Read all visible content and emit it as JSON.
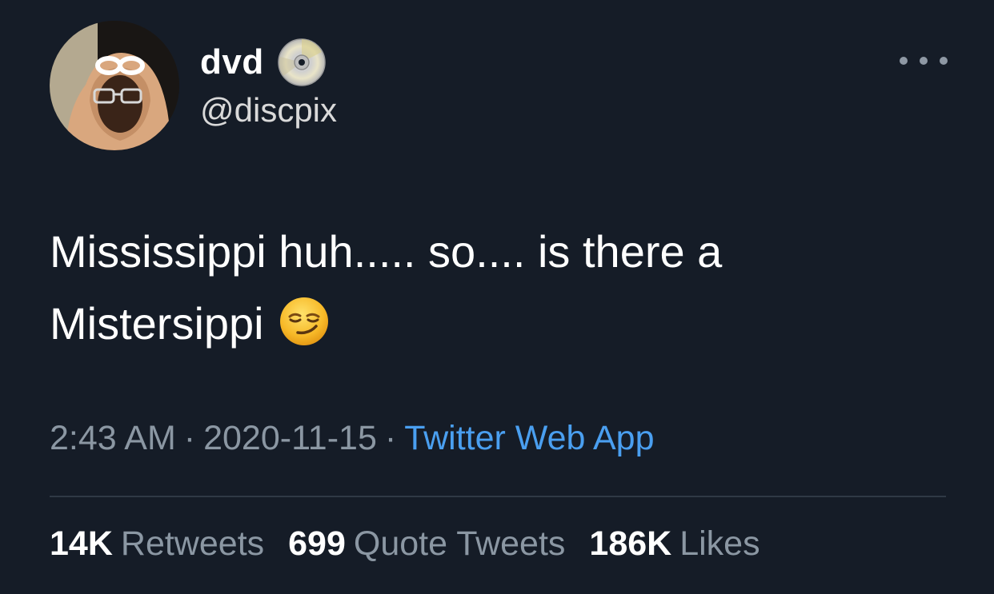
{
  "author": {
    "display_name": "dvd",
    "handle": "@discpix",
    "badge_icon": "dvd-disc-icon",
    "avatar_icon": "profile-avatar"
  },
  "tweet": {
    "text_line_1": "Mississippi huh..... so.... is there a",
    "text_line_2": "Mistersippi",
    "emoji": "smirking-face-emoji"
  },
  "meta": {
    "time": "2:43 AM",
    "separator": "·",
    "date": "2020-11-15",
    "source": "Twitter Web App"
  },
  "stats": {
    "retweets_count": "14K",
    "retweets_label": "Retweets",
    "quotes_count": "699",
    "quotes_label": "Quote Tweets",
    "likes_count": "186K",
    "likes_label": "Likes"
  },
  "menu_icon": "more-options-icon",
  "colors": {
    "background": "#151c27",
    "text_primary": "#ffffff",
    "text_secondary": "#8b97a3",
    "link": "#4a9ff0",
    "divider": "#2f3945"
  }
}
